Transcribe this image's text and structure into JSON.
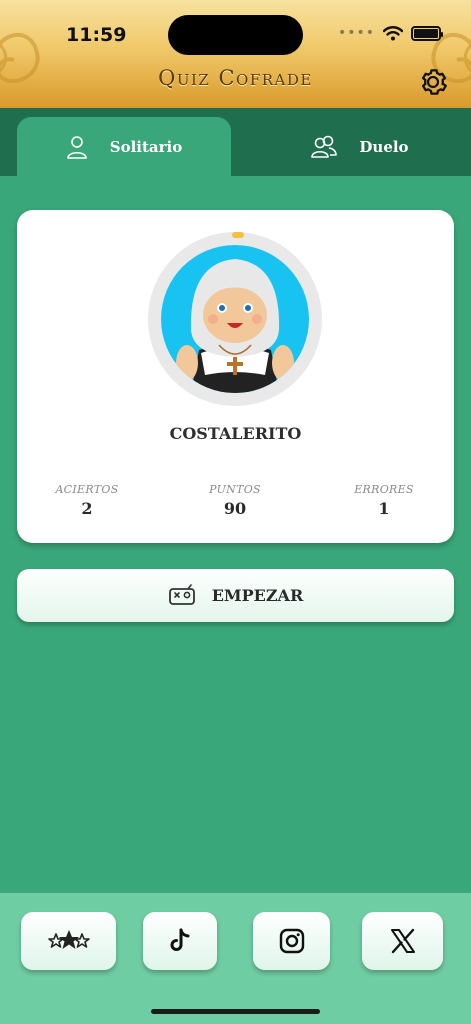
{
  "status_bar": {
    "time": "11:59"
  },
  "header": {
    "title": "Quiz Cofrade",
    "settings_icon": "gear-icon"
  },
  "tabs": [
    {
      "label": "Solitario",
      "icon": "person-icon",
      "active": true
    },
    {
      "label": "Duelo",
      "icon": "people-icon",
      "active": false
    }
  ],
  "profile": {
    "username": "COSTALERITO",
    "stats": [
      {
        "label": "ACIERTOS",
        "value": "2"
      },
      {
        "label": "PUNTOS",
        "value": "90"
      },
      {
        "label": "ERRORES",
        "value": "1"
      }
    ]
  },
  "start_button": {
    "label": "EMPEZAR",
    "icon": "game-controller-icon"
  },
  "bottom_bar": {
    "buttons": [
      {
        "icon": "stars-icon"
      },
      {
        "icon": "tiktok-icon"
      },
      {
        "icon": "instagram-icon"
      },
      {
        "icon": "x-icon"
      }
    ]
  },
  "colors": {
    "background": "#3aa77a",
    "tab_bar": "#1f6f4f",
    "header_gold": "#f0c869",
    "bottom_bar": "#6fcda3"
  }
}
